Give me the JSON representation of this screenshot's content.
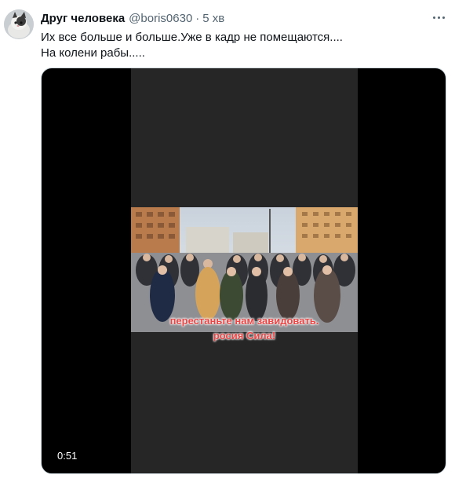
{
  "tweet": {
    "display_name": "Друг человека",
    "handle": "@boris0630",
    "separator": "·",
    "time": "5 хв",
    "text_lines": [
      "Их все больше и больше.Уже в кадр не помещаются....",
      "На колени рабы....."
    ],
    "avatar_icon": "cat-avatar-icon",
    "more_icon": "more-options-icon"
  },
  "video": {
    "caption_lines": [
      "перестаньте нам завидовать.",
      "росия Сила!"
    ],
    "duration": "0:51",
    "caption_color": "#e94545"
  },
  "colors": {
    "text_primary": "#0f1419",
    "text_secondary": "#536471",
    "border": "#cfd9de"
  }
}
